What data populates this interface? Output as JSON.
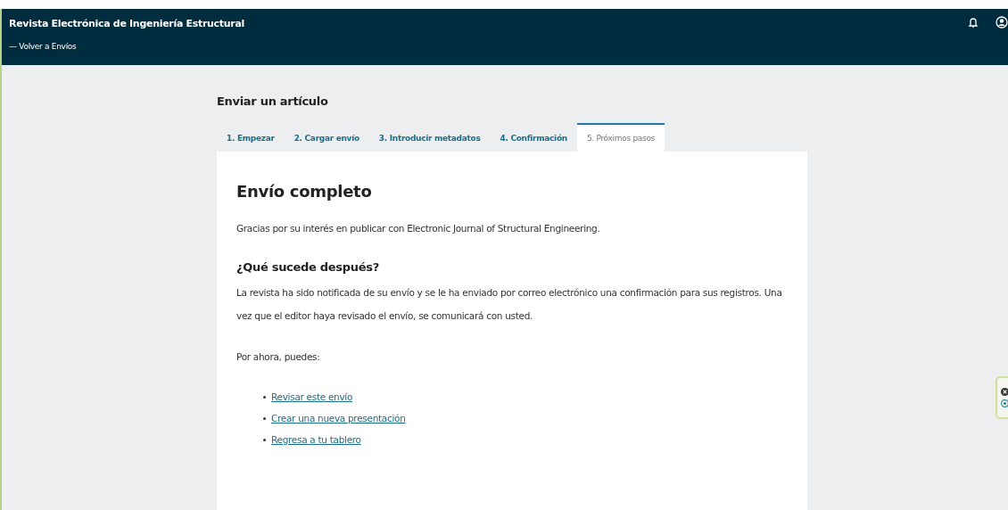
{
  "header": {
    "title": "Revista Electrónica de Ingeniería Estructural",
    "back_link": "— Volver a Envíos"
  },
  "page_title": "Enviar un artículo",
  "tabs": [
    {
      "label": "1. Empezar",
      "selected": false
    },
    {
      "label": "2. Cargar envío",
      "selected": false
    },
    {
      "label": "3. Introducir metadatos",
      "selected": false
    },
    {
      "label": "4. Confirmación",
      "selected": false
    },
    {
      "label": "5. Próximos pasos",
      "selected": true
    }
  ],
  "panel": {
    "heading": "Envío completo",
    "intro": "Gracias por su interés en publicar con Electronic Journal of Structural Engineering.",
    "subheading": "¿Qué sucede después?",
    "paragraph": "La revista ha sido notificada de su envío y se le ha enviado por correo electrónico una confirmación para sus registros. Una vez que el editor haya revisado el envío, se comunicará con usted.",
    "prompt": "Por ahora, puedes:",
    "links": [
      "Revisar este envío",
      "Crear una nueva presentación",
      "Regresa a tu tablero"
    ]
  }
}
